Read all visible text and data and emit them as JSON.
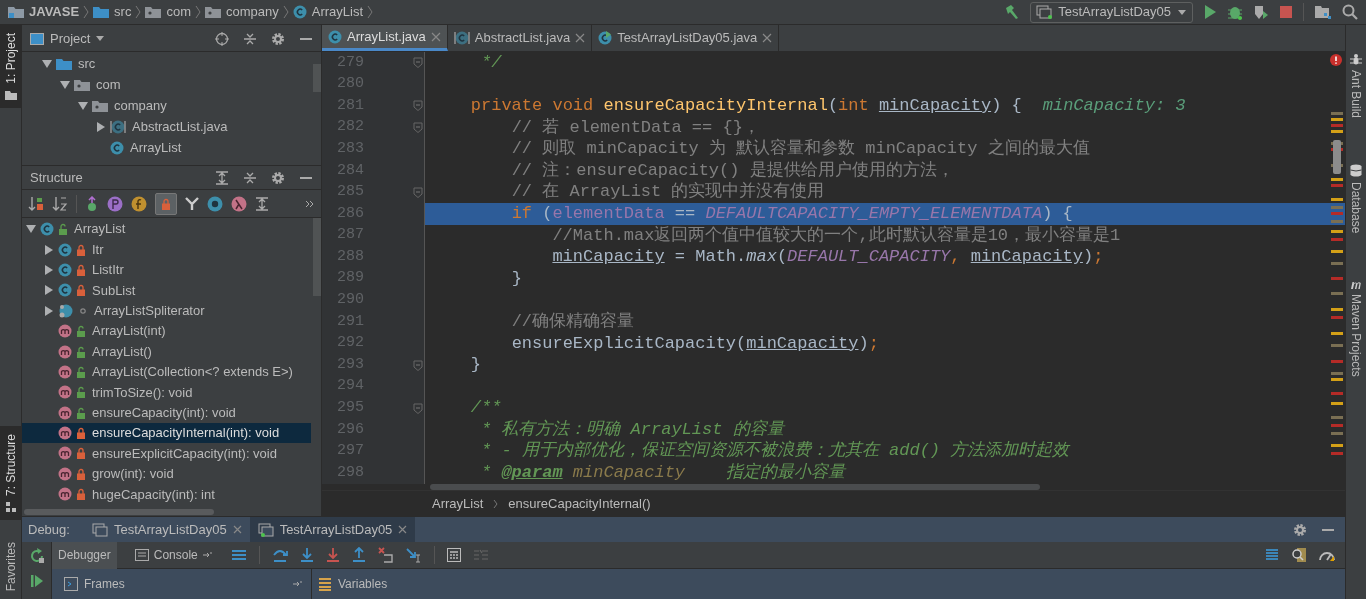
{
  "breadcrumbs": [
    {
      "label": "JAVASE",
      "kind": "module"
    },
    {
      "label": "src",
      "kind": "source"
    },
    {
      "label": "com",
      "kind": "package"
    },
    {
      "label": "company",
      "kind": "package"
    },
    {
      "label": "ArrayList",
      "kind": "class"
    }
  ],
  "run_config": "TestArrayListDay05",
  "left_stripe": {
    "top": [
      {
        "label": "1: Project",
        "selected": true
      }
    ],
    "bottom": [
      {
        "label": "7: Structure",
        "selected": true
      },
      {
        "label": "Favorites",
        "selected": false
      }
    ]
  },
  "project_panel": {
    "title": "Project",
    "tree": [
      {
        "label": "src",
        "kind": "source",
        "expanded": true,
        "children": [
          {
            "label": "com",
            "kind": "package",
            "expanded": true,
            "children": [
              {
                "label": "company",
                "kind": "package",
                "expanded": true,
                "children": [
                  {
                    "label": "AbstractList.java",
                    "kind": "abstract",
                    "expanded": false
                  },
                  {
                    "label": "ArrayList",
                    "kind": "class"
                  }
                ]
              }
            ]
          }
        ]
      }
    ]
  },
  "structure_panel": {
    "title": "Structure",
    "show_non_public": true,
    "tree": [
      {
        "label": "ArrayList",
        "kind": "public_class",
        "expanded": true,
        "selected": false,
        "children": [
          {
            "label": "Itr",
            "kind": "private_class",
            "expanded": false,
            "selected": false
          },
          {
            "label": "ListItr",
            "kind": "private_class",
            "expanded": false,
            "selected": false
          },
          {
            "label": "SubList",
            "kind": "private_class",
            "expanded": false,
            "selected": false
          },
          {
            "label": "ArrayListSpliterator",
            "kind": "package_static_class",
            "expanded": false,
            "selected": false
          },
          {
            "label": "ArrayList(int)",
            "kind": "public_method",
            "selected": false
          },
          {
            "label": "ArrayList()",
            "kind": "public_method",
            "selected": false
          },
          {
            "label": "ArrayList(Collection<? extends E>)",
            "kind": "public_method",
            "selected": false
          },
          {
            "label": "trimToSize(): void",
            "kind": "public_method",
            "selected": false
          },
          {
            "label": "ensureCapacity(int): void",
            "kind": "public_method",
            "selected": false
          },
          {
            "label": "ensureCapacityInternal(int): void",
            "kind": "private_method",
            "selected": true
          },
          {
            "label": "ensureExplicitCapacity(int): void",
            "kind": "private_method",
            "selected": false
          },
          {
            "label": "grow(int): void",
            "kind": "private_method",
            "selected": false
          },
          {
            "label": "hugeCapacity(int): int",
            "kind": "private_method",
            "selected": false
          }
        ]
      }
    ]
  },
  "editor": {
    "tabs": [
      {
        "label": "ArrayList.java",
        "kind": "class",
        "selected": true
      },
      {
        "label": "AbstractList.java",
        "kind": "abstract",
        "selected": false
      },
      {
        "label": "TestArrayListDay05.java",
        "kind": "runnable",
        "selected": false
      }
    ],
    "lines": [
      {
        "number": "279",
        "fold": true,
        "current": false,
        "tokens": [
          {
            "text": "     */",
            "kind": "doc"
          }
        ]
      },
      {
        "number": "280",
        "fold": false,
        "current": false
      },
      {
        "number": "281",
        "fold": true,
        "current": false,
        "tokens": [
          {
            "text": "    private",
            "kind": "keyword"
          },
          {
            "text": " void",
            "kind": "keyword"
          },
          {
            "text": " ensureCapacityInternal",
            "kind": "decl"
          },
          {
            "text": "(",
            "kind": "plain"
          },
          {
            "text": "int",
            "kind": "keyword"
          },
          {
            "text": " minCapacity",
            "kind": "param"
          },
          {
            "text": ") {",
            "kind": "plain"
          },
          {
            "text": "minCapacity: 3",
            "kind": "hint"
          }
        ]
      },
      {
        "number": "282",
        "fold": true,
        "current": false,
        "tokens": [
          {
            "text": "        // 若 elementData == {}，",
            "kind": "comment"
          }
        ]
      },
      {
        "number": "283",
        "fold": false,
        "current": false,
        "tokens": [
          {
            "text": "        // 则取 minCapacity 为 默认容量和参数 minCapacity 之间的最大值",
            "kind": "comment"
          }
        ]
      },
      {
        "number": "284",
        "fold": false,
        "current": false,
        "tokens": [
          {
            "text": "        // 注：ensureCapacity() 是提供给用户使用的方法，",
            "kind": "comment"
          }
        ]
      },
      {
        "number": "285",
        "fold": true,
        "current": false,
        "tokens": [
          {
            "text": "        // 在 ArrayList 的实现中并没有使用",
            "kind": "comment"
          }
        ]
      },
      {
        "number": "286",
        "fold": false,
        "current": true,
        "tokens": [
          {
            "text": "        if",
            "kind": "keyword"
          },
          {
            "text": " (",
            "kind": "plain"
          },
          {
            "text": "elementData",
            "kind": "field"
          },
          {
            "text": " == ",
            "kind": "plain"
          },
          {
            "text": "DEFAULTCAPACITY_EMPTY_ELEMENTDATA",
            "kind": "constant"
          },
          {
            "text": ") {",
            "kind": "plain"
          }
        ]
      },
      {
        "number": "287",
        "fold": false,
        "current": false,
        "tokens": [
          {
            "text": "            //Math.max返回两个值中值较大的一个,此时默认容量是10，最小容量是1",
            "kind": "comment"
          }
        ]
      },
      {
        "number": "288",
        "fold": false,
        "current": false,
        "tokens": [
          {
            "text": "            minCapacity",
            "kind": "param"
          },
          {
            "text": " = Math.",
            "kind": "plain"
          },
          {
            "text": "max",
            "kind": "static"
          },
          {
            "text": "(",
            "kind": "plain"
          },
          {
            "text": "DEFAULT_CAPACITY",
            "kind": "constant"
          },
          {
            "text": ",",
            "kind": "keyword"
          },
          {
            "text": " minCapacity",
            "kind": "param"
          },
          {
            "text": ")",
            "kind": "plain"
          },
          {
            "text": ";",
            "kind": "keyword"
          }
        ]
      },
      {
        "number": "289",
        "fold": false,
        "current": false,
        "tokens": [
          {
            "text": "        }",
            "kind": "plain"
          }
        ]
      },
      {
        "number": "290",
        "fold": false,
        "current": false
      },
      {
        "number": "291",
        "fold": false,
        "current": false,
        "tokens": [
          {
            "text": "        //确保精确容量",
            "kind": "comment"
          }
        ]
      },
      {
        "number": "292",
        "fold": false,
        "current": false,
        "tokens": [
          {
            "text": "        ensureExplicitCapacity(",
            "kind": "plain"
          },
          {
            "text": "minCapacity",
            "kind": "param"
          },
          {
            "text": ")",
            "kind": "plain"
          },
          {
            "text": ";",
            "kind": "keyword"
          }
        ]
      },
      {
        "number": "293",
        "fold": true,
        "current": false,
        "tokens": [
          {
            "text": "    }",
            "kind": "plain"
          }
        ]
      },
      {
        "number": "294",
        "fold": false,
        "current": false
      },
      {
        "number": "295",
        "fold": true,
        "current": false,
        "tokens": [
          {
            "text": "    /**",
            "kind": "doc"
          }
        ]
      },
      {
        "number": "296",
        "fold": false,
        "current": false,
        "tokens": [
          {
            "text": "     * 私有方法：明确 ArrayList 的容量",
            "kind": "doc"
          }
        ]
      },
      {
        "number": "297",
        "fold": false,
        "current": false,
        "tokens": [
          {
            "text": "     * - 用于内部优化，保证空间资源不被浪费：尤其在 add() 方法添加时起效",
            "kind": "doc"
          }
        ]
      },
      {
        "number": "298",
        "fold": false,
        "current": false,
        "tokens": [
          {
            "text": "     * ",
            "kind": "doc"
          },
          {
            "text": "@param",
            "kind": "doctag"
          },
          {
            "text": " minCapacity",
            "kind": "docparam"
          },
          {
            "text": "    指定的最小容量",
            "kind": "doc"
          }
        ]
      }
    ],
    "breadcrumb": [
      "ArrayList",
      "ensureCapacityInternal()"
    ]
  },
  "right_stripe": [
    {
      "label": "Ant Build",
      "kind": "ant"
    },
    {
      "label": "Database",
      "kind": "database"
    },
    {
      "label": "Maven Projects",
      "kind": "maven"
    }
  ],
  "debug": {
    "title": "Debug:",
    "sessions": [
      {
        "label": "TestArrayListDay05",
        "selected": false
      },
      {
        "label": "TestArrayListDay05",
        "selected": true
      }
    ],
    "views": [
      {
        "label": "Debugger",
        "selected": true
      },
      {
        "label": "Console",
        "selected": false
      }
    ],
    "frames_title": "Frames",
    "variables_title": "Variables"
  }
}
